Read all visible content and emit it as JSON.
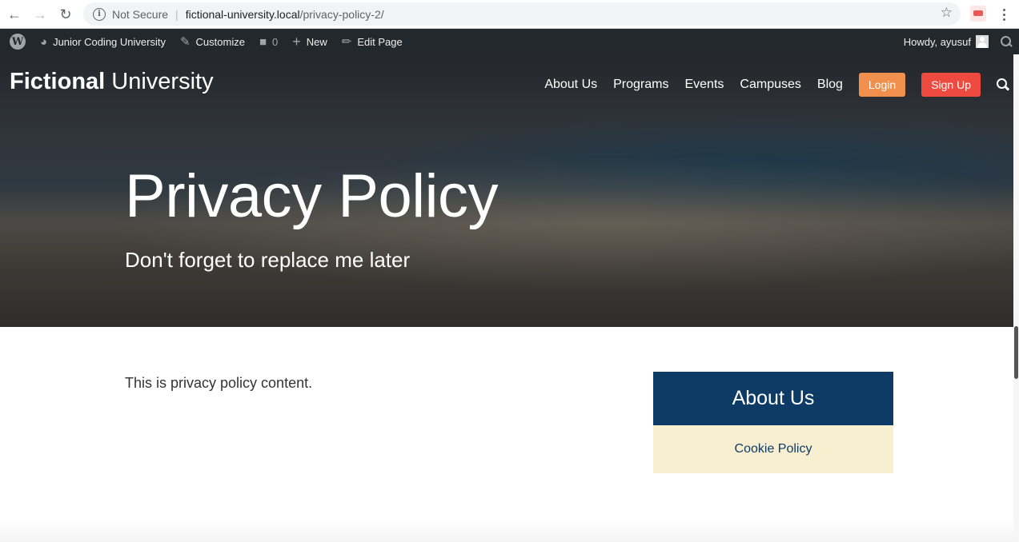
{
  "browser": {
    "security_label": "Not Secure",
    "url_host": "fictional-university.local",
    "url_path": "/privacy-policy-2/"
  },
  "adminbar": {
    "site_name": "Junior Coding University",
    "customize": "Customize",
    "comments_count": "0",
    "new": "New",
    "edit_page": "Edit Page",
    "howdy": "Howdy, ayusuf"
  },
  "site": {
    "title_bold": "Fictional",
    "title_rest": " University"
  },
  "nav": {
    "items": [
      "About Us",
      "Programs",
      "Events",
      "Campuses",
      "Blog"
    ],
    "login": "Login",
    "signup": "Sign Up"
  },
  "hero": {
    "title": "Privacy Policy",
    "subtitle": "Don't forget to replace me later"
  },
  "main": {
    "content": "This is privacy policy content."
  },
  "sidebar": {
    "heading": "About Us",
    "links": [
      "Cookie Policy"
    ]
  },
  "colors": {
    "adminbar": "#23282d",
    "login": "#f0904c",
    "signup": "#ef4a3f",
    "sidebar_head": "#0d3b66",
    "sidebar_link_bg": "#f8efd0"
  }
}
